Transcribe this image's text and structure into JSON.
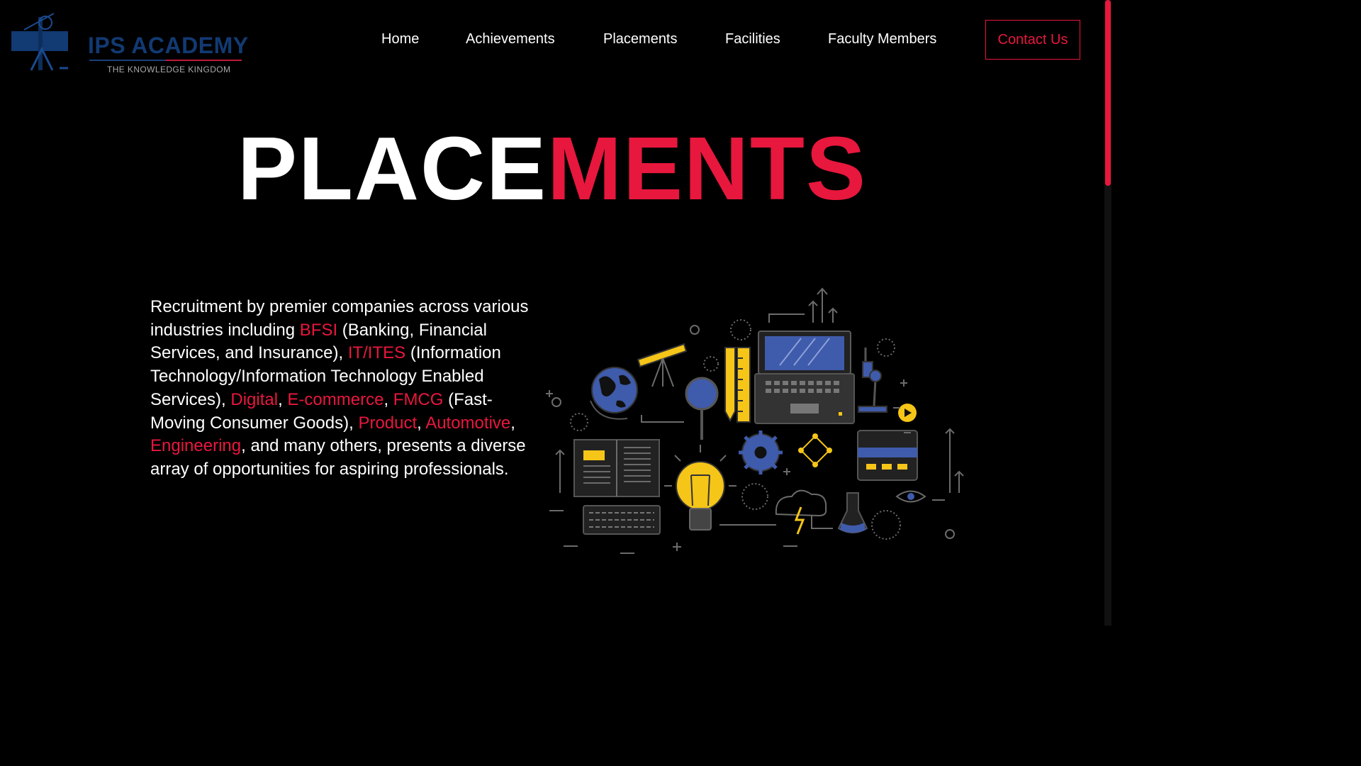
{
  "logo": {
    "title": "IPS ACADEMY",
    "tagline": "THE KNOWLEDGE KINGDOM",
    "icon": "academy-emblem-icon"
  },
  "nav": {
    "items": [
      {
        "label": "Home"
      },
      {
        "label": "Achievements"
      },
      {
        "label": "Placements"
      },
      {
        "label": "Facilities"
      },
      {
        "label": "Faculty Members"
      }
    ],
    "contact_label": "Contact Us"
  },
  "hero": {
    "title_white": "PLACE",
    "title_red": "MENTS"
  },
  "description": {
    "p1": "Recruitment by premier companies across various industries including ",
    "h1": "BFSI",
    "p2": " (Banking, Financial Services, and Insurance), ",
    "h2": "IT/ITES",
    "p3": " (Information Technology/Information Technology Enabled Services), ",
    "h3": "Digital",
    "p4": ", ",
    "h4": "E-commerce",
    "p5": ", ",
    "h5": "FMCG",
    "p6": " (Fast-Moving Consumer Goods), ",
    "h6": "Product",
    "p7": ", ",
    "h7": "Automotive",
    "p8": ", ",
    "h8": "Engineering",
    "p9": ", and many others, presents a diverse array of opportunities for aspiring professionals."
  },
  "illustration": {
    "icon": "education-technology-illustration-icon"
  },
  "colors": {
    "background": "#000000",
    "accent": "#e8173d",
    "text": "#ffffff",
    "logo_blue": "#123a73",
    "illus_blue": "#3f5bab",
    "illus_yellow": "#f5c518",
    "illus_line": "#6b6b6b"
  }
}
